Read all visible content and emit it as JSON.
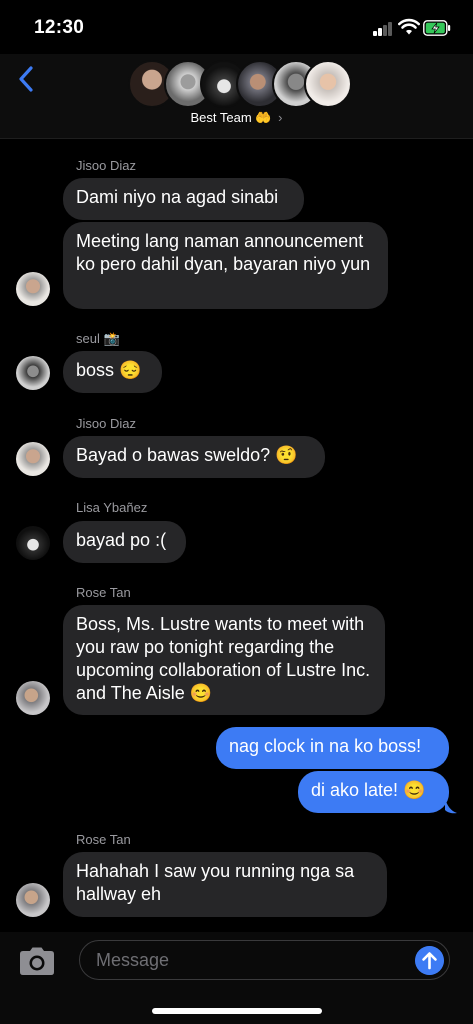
{
  "status_bar": {
    "time": "12:30"
  },
  "header": {
    "group_name": "Best Team",
    "group_emoji": "🤲",
    "chevron": "›"
  },
  "messages": [
    {
      "sender": "Jisoo Diaz",
      "texts": [
        "Dami niyo na agad sinabi",
        "Meeting lang naman announcement ko pero dahil dyan, bayaran niyo yun"
      ]
    },
    {
      "sender": "seul 📸",
      "texts": [
        "boss 😔"
      ]
    },
    {
      "sender": "Jisoo Diaz",
      "texts": [
        "Bayad o bawas sweldo? 🤨"
      ]
    },
    {
      "sender": "Lisa Ybañez",
      "texts": [
        "bayad po :("
      ]
    },
    {
      "sender": "Rose Tan",
      "texts": [
        "Boss, Ms. Lustre wants to meet with you raw po tonight regarding the upcoming collaboration of Lustre Inc. and The Aisle 😊"
      ]
    },
    {
      "sender": "me",
      "texts": [
        "nag clock in na ko boss!",
        "di ako late! 😊"
      ]
    },
    {
      "sender": "Rose Tan",
      "texts": [
        "Hahahah I saw you running nga sa hallway eh"
      ]
    }
  ],
  "composer": {
    "placeholder": "Message"
  },
  "icons": {
    "back": "chevron-left-icon",
    "camera": "camera-icon",
    "send": "arrow-up-icon",
    "signal": "cellular-signal-icon",
    "wifi": "wifi-icon",
    "battery": "battery-charging-icon"
  },
  "colors": {
    "background": "#000000",
    "incoming_bubble": "#262628",
    "outgoing_bubble": "#3d7bf4",
    "accent": "#3d7bf4",
    "battery_fill": "#34c759"
  }
}
